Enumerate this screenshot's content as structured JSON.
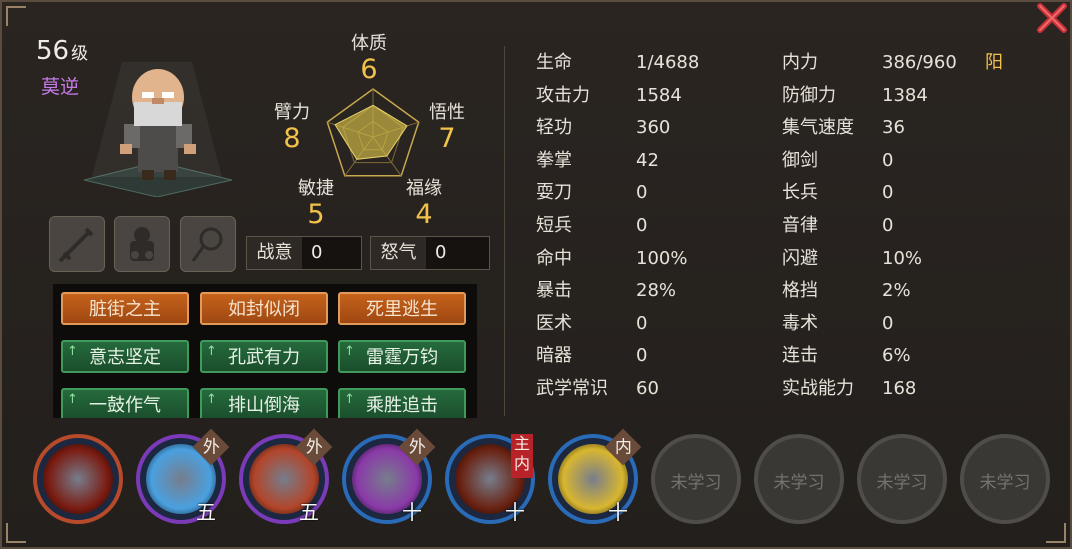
{
  "header": {
    "level": "56",
    "level_unit": "级",
    "name": "莫逆"
  },
  "attributes": [
    {
      "label": "体质",
      "value": "6"
    },
    {
      "label": "悟性",
      "value": "7"
    },
    {
      "label": "福缘",
      "value": "4"
    },
    {
      "label": "敏捷",
      "value": "5"
    },
    {
      "label": "臂力",
      "value": "8"
    }
  ],
  "meters": [
    {
      "label": "战意",
      "value": "0"
    },
    {
      "label": "怒气",
      "value": "0"
    }
  ],
  "traits": [
    {
      "label": "脏街之主",
      "color": "orange",
      "upgrade": false
    },
    {
      "label": "如封似闭",
      "color": "orange",
      "upgrade": false
    },
    {
      "label": "死里逃生",
      "color": "orange",
      "upgrade": false
    },
    {
      "label": "意志坚定",
      "color": "green",
      "upgrade": true
    },
    {
      "label": "孔武有力",
      "color": "green",
      "upgrade": true
    },
    {
      "label": "雷霆万钧",
      "color": "green",
      "upgrade": true
    },
    {
      "label": "一鼓作气",
      "color": "green",
      "upgrade": true
    },
    {
      "label": "排山倒海",
      "color": "green",
      "upgrade": true
    },
    {
      "label": "乘胜追击",
      "color": "green",
      "upgrade": true
    }
  ],
  "stats_left": [
    {
      "label": "生命",
      "value": "1/4688"
    },
    {
      "label": "攻击力",
      "value": "1584"
    },
    {
      "label": "轻功",
      "value": "360"
    },
    {
      "label": "拳掌",
      "value": "42"
    },
    {
      "label": "耍刀",
      "value": "0"
    },
    {
      "label": "短兵",
      "value": "0"
    },
    {
      "label": "命中",
      "value": "100%"
    },
    {
      "label": "暴击",
      "value": "28%"
    },
    {
      "label": "医术",
      "value": "0"
    },
    {
      "label": "暗器",
      "value": "0"
    },
    {
      "label": "武学常识",
      "value": "60"
    }
  ],
  "stats_right": [
    {
      "label": "内力",
      "value": "386/960"
    },
    {
      "label": "防御力",
      "value": "1384"
    },
    {
      "label": "集气速度",
      "value": "36"
    },
    {
      "label": "御剑",
      "value": "0"
    },
    {
      "label": "长兵",
      "value": "0"
    },
    {
      "label": "音律",
      "value": "0"
    },
    {
      "label": "闪避",
      "value": "10%"
    },
    {
      "label": "格挡",
      "value": "2%"
    },
    {
      "label": "毒术",
      "value": "0"
    },
    {
      "label": "连击",
      "value": "6%"
    },
    {
      "label": "实战能力",
      "value": "168"
    }
  ],
  "neili_type": "阳",
  "skills": [
    {
      "icon": "sun-emblem-icon",
      "tag": "",
      "tier": "",
      "ring": "#b64a2a",
      "img": "#7a1c12",
      "locked": false
    },
    {
      "icon": "ice-palm-icon",
      "tag": "外",
      "tier": "五",
      "ring": "#7b3bb8",
      "img": "#4aa0e0",
      "locked": false
    },
    {
      "icon": "clasped-hands-icon",
      "tag": "外",
      "tier": "五",
      "ring": "#7b3bb8",
      "img": "#b2452a",
      "locked": false
    },
    {
      "icon": "purple-palm-icon",
      "tag": "外",
      "tier": "十",
      "ring": "#2a6bb8",
      "img": "#8a3aa8",
      "locked": false
    },
    {
      "icon": "roaring-maw-icon",
      "tag": "主内",
      "tier": "十",
      "ring": "#2a6bb8",
      "img": "#6a2212",
      "locked": false
    },
    {
      "icon": "golden-sun-icon",
      "tag": "内",
      "tier": "十",
      "ring": "#2a6bb8",
      "img": "#d8b630",
      "locked": false
    },
    {
      "label": "未学习",
      "locked": true
    },
    {
      "label": "未学习",
      "locked": true
    },
    {
      "label": "未学习",
      "locked": true
    },
    {
      "label": "未学习",
      "locked": true
    }
  ]
}
